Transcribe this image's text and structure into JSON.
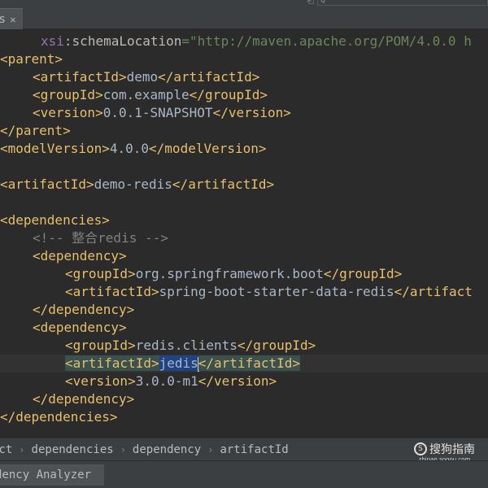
{
  "tabs": {
    "active_label": "s",
    "close_glyph": "✕"
  },
  "top_right": {
    "icon": "⎗",
    "field_text": "Q"
  },
  "editor": {
    "line1": {
      "ns": "xsi",
      "colon": ":",
      "attr": "schemaLocation",
      "eq": "=",
      "value": "\"http://maven.apache.org/POM/4.0.0 h"
    },
    "parent_open": "<parent>",
    "artifactId_open": "<artifactId>",
    "artifactId_close": "</artifactId>",
    "groupId_open": "<groupId>",
    "groupId_close": "</groupId>",
    "version_open": "<version>",
    "version_close": "</version>",
    "parent_close": "</parent>",
    "modelVersion_open": "<modelVersion>",
    "modelVersion_close": "</modelVersion>",
    "dependencies_open": "<dependencies>",
    "dependencies_close": "</dependencies>",
    "dependency_open": "<dependency>",
    "dependency_close": "</dependency>",
    "artifactId_trunc": "</artifact",
    "parent_artifact": "demo",
    "parent_group": "com.example",
    "parent_version": "0.0.1-SNAPSHOT",
    "model_version": "4.0.0",
    "project_artifact": "demo-redis",
    "comment": "<!-- 整合redis -->",
    "dep1_group": "org.springframework.boot",
    "dep1_artifact": "spring-boot-starter-data-redis",
    "dep2_group": "redis.clients",
    "dep2_artifact": "jedis",
    "dep2_version": "3.0.0-m1"
  },
  "breadcrumbs": {
    "items": [
      "ect",
      "dependencies",
      "dependency",
      "artifactId"
    ],
    "separator": "›"
  },
  "watermark": {
    "logo": "S",
    "main": "搜狗指南",
    "sub": "zhinan.sogou.com"
  },
  "bottom": {
    "tab_label": "dency Analyzer"
  },
  "colors": {
    "background": "#2b2b2b",
    "tag": "#e8bf6a",
    "text": "#a9b7c6",
    "string": "#6a8759",
    "comment": "#808080",
    "namespace": "#9876aa",
    "selection": "#214283"
  }
}
